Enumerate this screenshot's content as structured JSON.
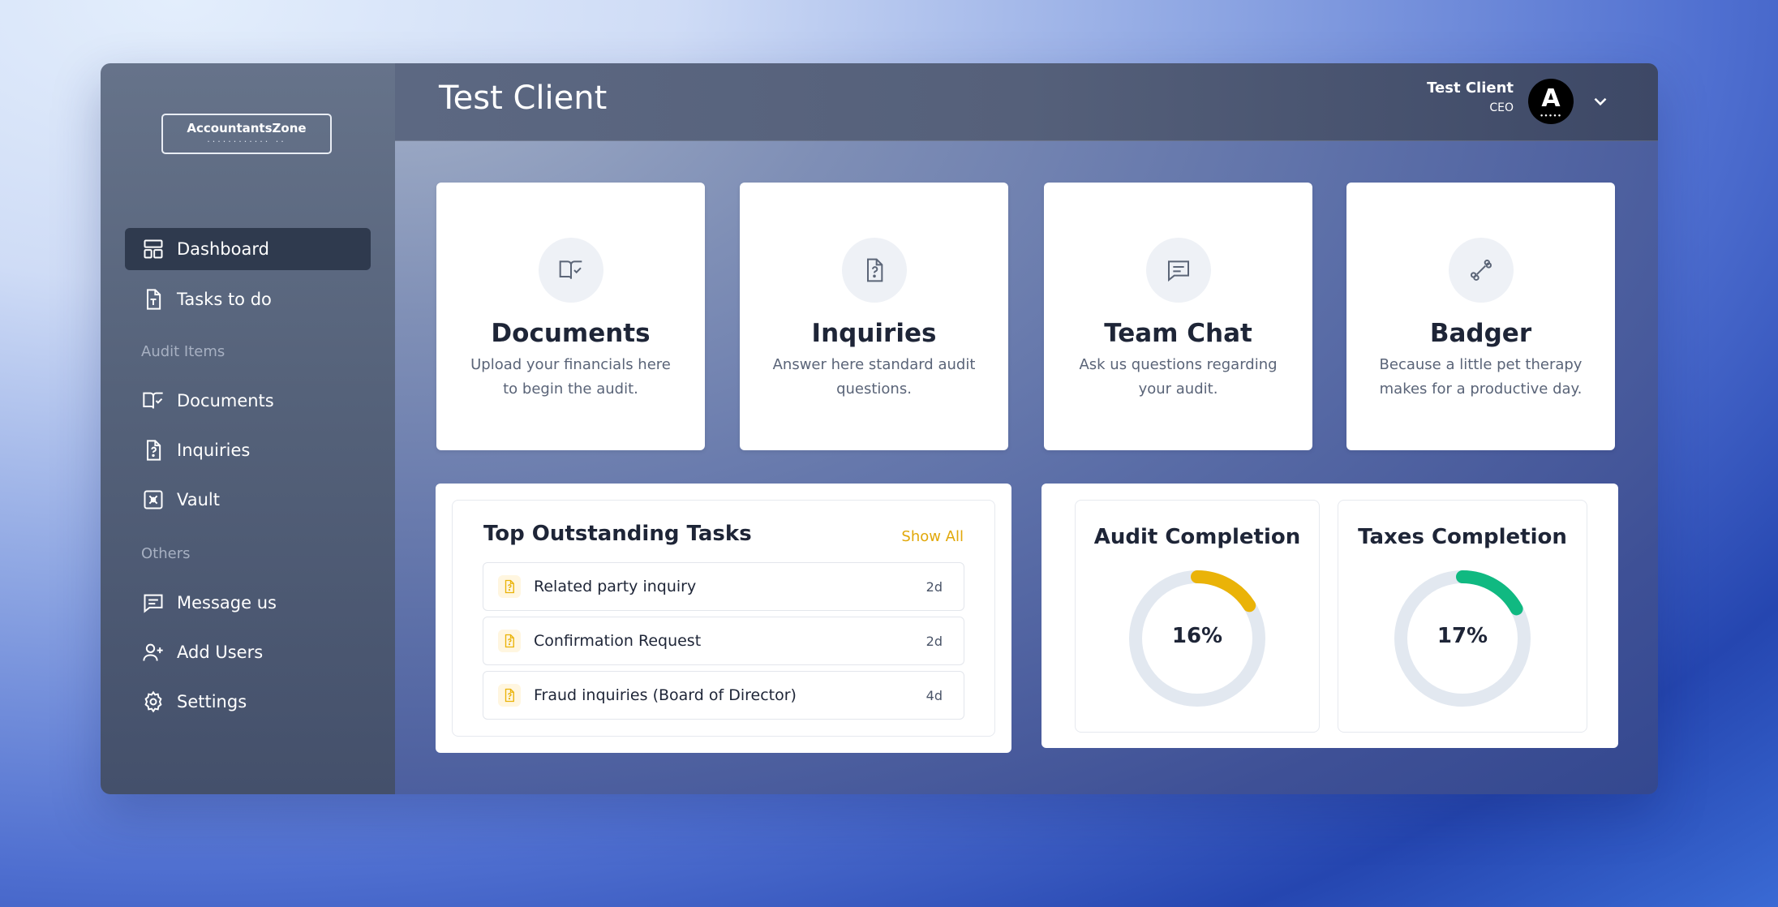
{
  "sidebar": {
    "logo": {
      "text": "AccountantsZone",
      "dots": "............ .."
    },
    "items": [
      {
        "label": "Dashboard",
        "icon": "layout-icon"
      },
      {
        "label": "Tasks to do",
        "icon": "task-file-icon"
      },
      {
        "label": "Documents",
        "icon": "book-check-icon"
      },
      {
        "label": "Inquiries",
        "icon": "question-file-icon"
      },
      {
        "label": "Vault",
        "icon": "vault-icon"
      },
      {
        "label": "Message us",
        "icon": "message-icon"
      },
      {
        "label": "Add Users",
        "icon": "user-plus-icon"
      },
      {
        "label": "Settings",
        "icon": "gear-icon"
      }
    ],
    "sections": {
      "audit": "Audit Items",
      "others": "Others"
    }
  },
  "header": {
    "title": "Test Client",
    "user_name": "Test Client",
    "user_role": "CEO",
    "avatar_letter": "A",
    "avatar_dots": "•••••"
  },
  "cards": [
    {
      "title": "Documents",
      "desc": "Upload your financials here to begin the audit.",
      "icon": "book-check-icon"
    },
    {
      "title": "Inquiries",
      "desc": "Answer here standard audit questions.",
      "icon": "question-file-icon"
    },
    {
      "title": "Team Chat",
      "desc": "Ask us questions regarding your audit.",
      "icon": "chat-icon"
    },
    {
      "title": "Badger",
      "desc": "Because a little pet therapy makes for a productive day.",
      "icon": "bone-icon"
    }
  ],
  "tasks": {
    "title": "Top Outstanding Tasks",
    "show_all": "Show All",
    "rows": [
      {
        "name": "Related party inquiry",
        "age": "2d"
      },
      {
        "name": "Confirmation Request",
        "age": "2d"
      },
      {
        "name": "Fraud inquiries (Board of Director)",
        "age": "4d"
      }
    ]
  },
  "completion": {
    "audit": {
      "title": "Audit Completion",
      "label": "16%",
      "value": 0.16,
      "color": "#eab308"
    },
    "taxes": {
      "title": "Taxes Completion",
      "label": "17%",
      "value": 0.17,
      "color": "#10b981"
    }
  },
  "colors": {
    "accent": "#e1a80a",
    "active_nav": "#2f3a4e"
  }
}
